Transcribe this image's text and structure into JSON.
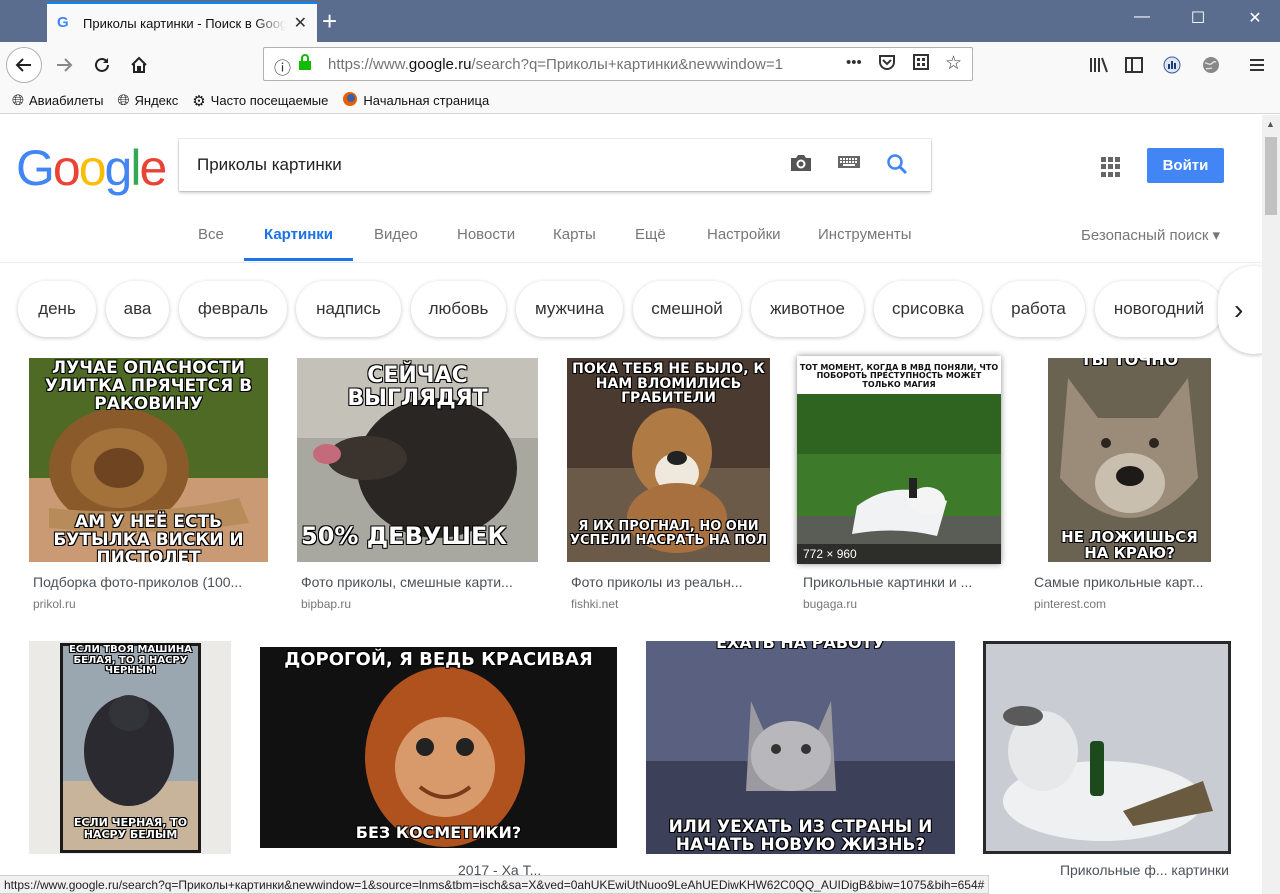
{
  "browser": {
    "tab_title": "Приколы картинки - Поиск в Google",
    "tab_close": "✕",
    "new_tab": "+",
    "window_controls": {
      "minimize": "—",
      "maximize": "☐",
      "close": "✕"
    },
    "url_prefix": "https://www.",
    "url_domain": "google.ru",
    "url_rest": "/search?q=Приколы+картинки&newwindow=1",
    "bookmarks": [
      {
        "label": "Авиабилеты",
        "icon": "globe-icon"
      },
      {
        "label": "Яндекс",
        "icon": "globe-icon"
      },
      {
        "label": "Часто посещаемые",
        "icon": "gear-icon"
      },
      {
        "label": "Начальная страница",
        "icon": "firefox-icon"
      }
    ],
    "status_url": "https://www.google.ru/search?q=Приколы+картинки&newwindow=1&source=lnms&tbm=isch&sa=X&ved=0ahUKEwiUtNuoo9LeAhUEDiwKHW62C0QQ_AUIDigB&biw=1075&bih=654#"
  },
  "google": {
    "search_query": "Приколы картинки",
    "signin": "Войти",
    "tabs": [
      "Все",
      "Картинки",
      "Видео",
      "Новости",
      "Карты",
      "Ещё",
      "Настройки",
      "Инструменты"
    ],
    "active_tab": "Картинки",
    "safe_search": "Безопасный поиск ▾"
  },
  "chips": [
    "день",
    "ава",
    "февраль",
    "надпись",
    "любовь",
    "мужчина",
    "смешной",
    "животное",
    "срисовка",
    "работа",
    "новогодний"
  ],
  "results_row1": [
    {
      "top": "Лучае опасности улитка прячется в раковину",
      "bottom": "Ам у неё есть бутылка виски и пистолет",
      "caption": "Подборка фото-приколов (100...",
      "source": "prikol.ru"
    },
    {
      "top": "Сейчас выглядят",
      "bottom": "50% девушек",
      "caption": "Фото приколы, смешные карти...",
      "source": "bipbap.ru"
    },
    {
      "top": "Пока тебя не было, к нам вломились грабители",
      "bottom": "Я их прогнал, но они успели насрать на пол",
      "caption": "Фото приколы из реальн...",
      "source": "fishki.net"
    },
    {
      "top": "Тот момент, когда в МВД поняли, что побороть преступность может только магия",
      "bottom": "",
      "dimensions": "772 × 960",
      "caption": "Прикольные картинки и ...",
      "source": "bugaga.ru"
    },
    {
      "top": "Ты точно",
      "bottom": "Не ложишься на краю?",
      "caption": "Самые прикольные карт...",
      "source": "pinterest.com"
    }
  ],
  "results_row2": [
    {
      "top": "Если твоя машина белая, то я насру черным",
      "bottom": "Если черная, то насру белым"
    },
    {
      "top": "Дорогой, я ведь красивая",
      "bottom": "Без косметики?"
    },
    {
      "top": "Ехать на работу",
      "bottom": "Или уехать из страны и начать новую жизнь?",
      "caption_fragment": "2017 - Ха Т..."
    },
    {
      "top": "",
      "bottom": "",
      "caption_fragment": "Прикольные ф... картинки"
    }
  ],
  "colors": {
    "google_blue": "#4285f4",
    "active_tab": "#1a73e8",
    "chrome": "#5b6d8e"
  }
}
